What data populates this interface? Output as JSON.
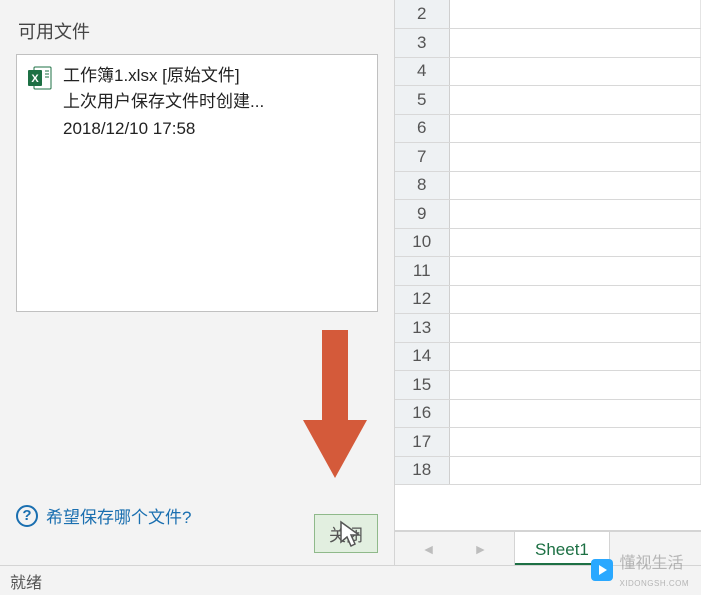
{
  "panel": {
    "title": "可用文件",
    "file": {
      "name_line": "工作簿1.xlsx  [原始文件]",
      "desc_line": "上次用户保存文件时创建...",
      "time_line": "2018/12/10 17:58"
    },
    "help_text": "希望保存哪个文件?",
    "close_label": "关闭"
  },
  "grid": {
    "rows": [
      2,
      3,
      4,
      5,
      6,
      7,
      8,
      9,
      10,
      11,
      12,
      13,
      14,
      15,
      16,
      17,
      18
    ]
  },
  "tab": {
    "sheet_name": "Sheet1"
  },
  "status": {
    "text": "就绪"
  },
  "watermark": {
    "text": "懂视生活",
    "sub": "XIDONGSH.COM"
  },
  "colors": {
    "accent_green": "#1d7044",
    "arrow": "#d45a3a",
    "link": "#1a6fb0"
  }
}
